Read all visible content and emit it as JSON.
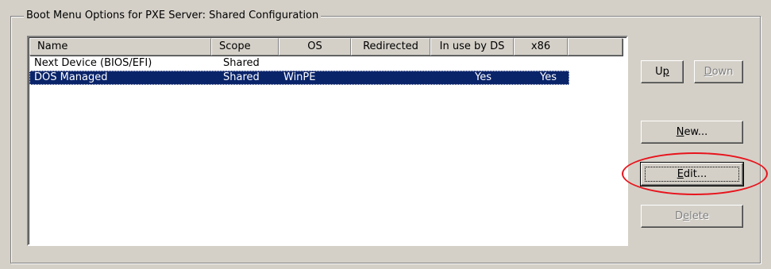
{
  "group": {
    "title": "Boot Menu Options for PXE Server:  Shared Configuration"
  },
  "list": {
    "columns": [
      "Name",
      "Scope",
      "OS",
      "Redirected",
      "In use by DS",
      "x86",
      ""
    ],
    "rows": [
      {
        "name": "Next Device (BIOS/EFI)",
        "scope": "Shared",
        "os": "",
        "redirected": "",
        "in_use": "",
        "x86": "",
        "selected": false
      },
      {
        "name": "DOS Managed",
        "scope": "Shared",
        "os": "WinPE",
        "redirected": "",
        "in_use": "Yes",
        "x86": "Yes",
        "selected": true
      }
    ]
  },
  "buttons": {
    "up": {
      "pre": "U",
      "acc": "p",
      "post": ""
    },
    "down": {
      "pre": "",
      "acc": "D",
      "post": "own"
    },
    "new": {
      "pre": "",
      "acc": "N",
      "post": "ew..."
    },
    "edit": {
      "pre": "",
      "acc": "E",
      "post": "dit..."
    },
    "delete": {
      "pre": "D",
      "acc": "e",
      "post": "lete"
    }
  },
  "colors": {
    "selection": "#0a246a",
    "annotation": "#e8141c",
    "face": "#d4d0c8"
  }
}
